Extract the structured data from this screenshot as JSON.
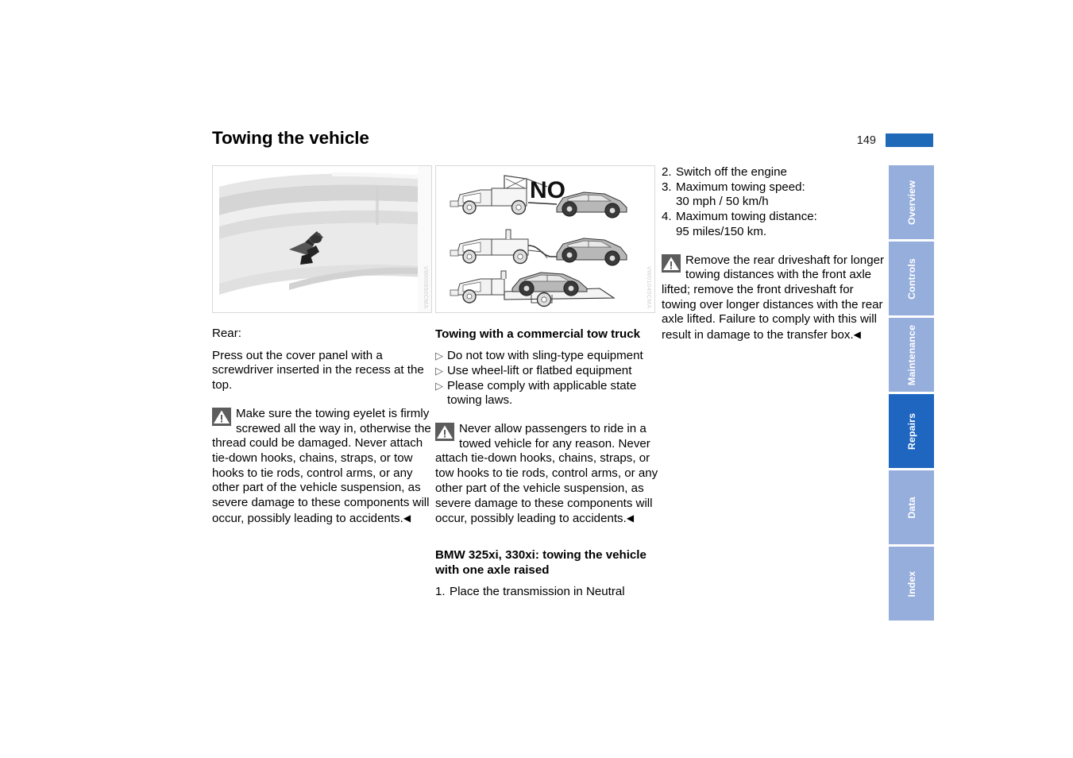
{
  "header": {
    "title": "Towing the vehicle",
    "page_number": "149",
    "accent_color": "#1f6ab8"
  },
  "figures": [
    {
      "name": "rear-bumper-towing-eyelet-figure",
      "watermark": "VW00850CMA",
      "alt": "Rear bumper with cover panel being pried out by a screwdriver"
    },
    {
      "name": "tow-truck-methods-figure",
      "watermark": "VW01045CMA",
      "alt": "Three tow truck methods: sling-type marked NO, wheel-lift, and flatbed",
      "overlay_text": "NO"
    }
  ],
  "left_column": {
    "caption": "Rear:",
    "paragraph": "Press out the cover panel with a screwdriver inserted in the recess at the top.",
    "warning": {
      "icon": "warning-triangle-icon",
      "text": "Make sure the towing eyelet is firmly screwed all the way in, otherwise the thread could be damaged. Never attach tie-down hooks, chains, straps, or tow hooks to tie rods, control arms, or any other part of the vehicle suspension, as severe damage to these components will occur, possibly leading to accidents.",
      "endmark": "◀"
    }
  },
  "middle_column": {
    "heading": "Towing with a commercial tow truck",
    "bullet_marker": "▷",
    "bullets": [
      "Do not tow with sling-type equipment",
      "Use wheel-lift or flatbed equipment",
      "Please comply with applicable state towing laws."
    ],
    "warning": {
      "icon": "warning-triangle-icon",
      "text": "Never allow passengers to ride in a towed vehicle for any reason. Never attach tie-down hooks, chains, straps, or tow hooks to tie rods, control arms, or any other part of the vehicle suspension, as severe damage to these components will occur, possibly leading to accidents.",
      "endmark": "◀"
    },
    "heading2": "BMW 325xi, 330xi: towing the vehicle with one axle raised",
    "steps": [
      {
        "num": "1.",
        "text": "Place the transmission in Neutral"
      }
    ]
  },
  "right_column": {
    "steps": [
      {
        "num": "2.",
        "text": "Switch off the engine",
        "cont": ""
      },
      {
        "num": "3.",
        "text": "Maximum towing speed:",
        "cont": "30 mph / 50 km/h"
      },
      {
        "num": "4.",
        "text": "Maximum towing distance:",
        "cont": "95 miles/150 km."
      }
    ],
    "warning": {
      "icon": "warning-triangle-icon",
      "text": "Remove the rear driveshaft for longer towing distances with the front axle lifted; remove the front driveshaft for towing over longer distances with the rear axle lifted. Failure to comply with this will result in damage to the transfer box.",
      "endmark": "◀"
    }
  },
  "tabs": [
    {
      "label": "Overview",
      "active": false
    },
    {
      "label": "Controls",
      "active": false
    },
    {
      "label": "Maintenance",
      "active": false
    },
    {
      "label": "Repairs",
      "active": true
    },
    {
      "label": "Data",
      "active": false
    },
    {
      "label": "Index",
      "active": false
    }
  ],
  "tab_colors": {
    "inactive": "#96aedc",
    "active": "#1f66c0",
    "label": "#ffffff"
  }
}
